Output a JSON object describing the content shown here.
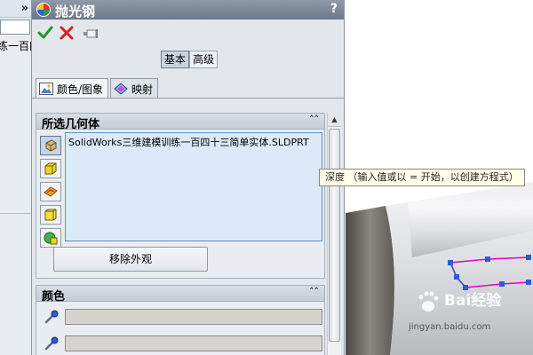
{
  "left_panel": {
    "collapse_label": "»",
    "tree_item_text": "练一百四"
  },
  "property_manager": {
    "title": "抛光钢",
    "help_label": "?",
    "mode_tabs": [
      {
        "label": "基本",
        "active": true
      },
      {
        "label": "高级",
        "active": false
      }
    ],
    "tabs": [
      {
        "label": "颜色/图象",
        "icon": "image-icon",
        "active": true
      },
      {
        "label": "映射",
        "icon": "mapping-icon",
        "active": false
      }
    ],
    "geometry_group": {
      "title": "所选几何体",
      "selected_item": "SolidWorks三维建模训练一百四十三简单实体.SLDPRT",
      "filter_buttons": [
        "part-filter-icon",
        "body-filter-icon",
        "face-filter-icon",
        "feature-filter-icon",
        "selection-filter-icon"
      ],
      "remove_button": "移除外观"
    },
    "color_group": {
      "title": "颜色"
    }
  },
  "tooltip": {
    "text": "深度 （输入值或以 = 开始，以创建方程式）"
  },
  "watermark": {
    "brand": "Bai经验",
    "url": "jingyan.baidu.com"
  },
  "colors": {
    "title_bar": "#6d7888",
    "selection_box": "#dbe9f8",
    "sketch_line": "#e000c8",
    "sketch_point": "#2b5bd6",
    "model_dark": "#5a5652"
  }
}
